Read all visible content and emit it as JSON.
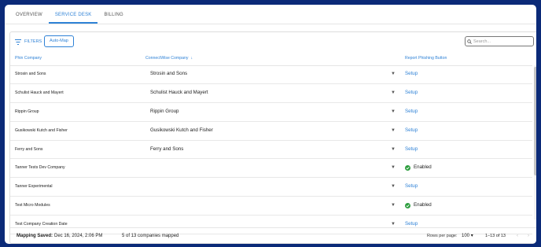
{
  "tabs": [
    {
      "label": "OVERVIEW"
    },
    {
      "label": "SERVICE DESK"
    },
    {
      "label": "BILLING"
    }
  ],
  "toolbar": {
    "filters_label": "FILTERS",
    "automap_label": "Auto-Map",
    "search_placeholder": "Search..."
  },
  "table": {
    "headers": {
      "phin_company": "Phin Company",
      "cw_company": "ConnectWise Company",
      "report_button": "Report Phishing Button"
    },
    "rows": [
      {
        "phin": "Strosin and Sons",
        "cw": "Strosin and Sons",
        "action": "Setup",
        "status": "setup"
      },
      {
        "phin": "Schulist Hauck and Mayert",
        "cw": "Schulist Hauck and Mayert",
        "action": "Setup",
        "status": "setup"
      },
      {
        "phin": "Rippin Group",
        "cw": "Rippin Group",
        "action": "Setup",
        "status": "setup"
      },
      {
        "phin": "Gusikowski Kutch and Fisher",
        "cw": "Gusikowski Kutch and Fisher",
        "action": "Setup",
        "status": "setup"
      },
      {
        "phin": "Ferry and Sons",
        "cw": "Ferry and Sons",
        "action": "Setup",
        "status": "setup"
      },
      {
        "phin": "Tanner Tests Dev Company",
        "cw": "",
        "action": "Enabled",
        "status": "enabled"
      },
      {
        "phin": "Tanner Experimental",
        "cw": "",
        "action": "Setup",
        "status": "setup"
      },
      {
        "phin": "Test Micro Modules",
        "cw": "",
        "action": "Enabled",
        "status": "enabled"
      },
      {
        "phin": "Test Company Creation Date",
        "cw": "",
        "action": "Setup",
        "status": "setup"
      }
    ]
  },
  "footer": {
    "saved_label": "Mapping Saved:",
    "saved_date": "Dec 16, 2024, 2:06 PM",
    "mapped_text": "5 of 13 companies mapped",
    "rows_per_page_label": "Rows per page:",
    "rows_per_page_value": "100",
    "range_text": "1–13 of 13"
  },
  "colors": {
    "accent": "#2f82d6",
    "enabled": "#2e9e3f",
    "frame": "#0b2a78"
  }
}
